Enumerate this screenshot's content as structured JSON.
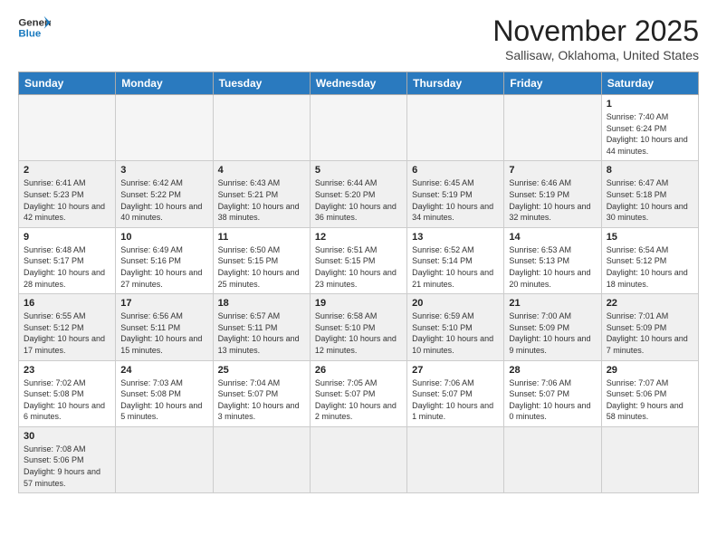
{
  "header": {
    "logo_general": "General",
    "logo_blue": "Blue",
    "month_title": "November 2025",
    "location": "Sallisaw, Oklahoma, United States"
  },
  "days_of_week": [
    "Sunday",
    "Monday",
    "Tuesday",
    "Wednesday",
    "Thursday",
    "Friday",
    "Saturday"
  ],
  "weeks": [
    [
      {
        "day": "",
        "info": ""
      },
      {
        "day": "",
        "info": ""
      },
      {
        "day": "",
        "info": ""
      },
      {
        "day": "",
        "info": ""
      },
      {
        "day": "",
        "info": ""
      },
      {
        "day": "",
        "info": ""
      },
      {
        "day": "1",
        "info": "Sunrise: 7:40 AM\nSunset: 6:24 PM\nDaylight: 10 hours and 44 minutes."
      }
    ],
    [
      {
        "day": "2",
        "info": "Sunrise: 6:41 AM\nSunset: 5:23 PM\nDaylight: 10 hours and 42 minutes."
      },
      {
        "day": "3",
        "info": "Sunrise: 6:42 AM\nSunset: 5:22 PM\nDaylight: 10 hours and 40 minutes."
      },
      {
        "day": "4",
        "info": "Sunrise: 6:43 AM\nSunset: 5:21 PM\nDaylight: 10 hours and 38 minutes."
      },
      {
        "day": "5",
        "info": "Sunrise: 6:44 AM\nSunset: 5:20 PM\nDaylight: 10 hours and 36 minutes."
      },
      {
        "day": "6",
        "info": "Sunrise: 6:45 AM\nSunset: 5:19 PM\nDaylight: 10 hours and 34 minutes."
      },
      {
        "day": "7",
        "info": "Sunrise: 6:46 AM\nSunset: 5:19 PM\nDaylight: 10 hours and 32 minutes."
      },
      {
        "day": "8",
        "info": "Sunrise: 6:47 AM\nSunset: 5:18 PM\nDaylight: 10 hours and 30 minutes."
      }
    ],
    [
      {
        "day": "9",
        "info": "Sunrise: 6:48 AM\nSunset: 5:17 PM\nDaylight: 10 hours and 28 minutes."
      },
      {
        "day": "10",
        "info": "Sunrise: 6:49 AM\nSunset: 5:16 PM\nDaylight: 10 hours and 27 minutes."
      },
      {
        "day": "11",
        "info": "Sunrise: 6:50 AM\nSunset: 5:15 PM\nDaylight: 10 hours and 25 minutes."
      },
      {
        "day": "12",
        "info": "Sunrise: 6:51 AM\nSunset: 5:15 PM\nDaylight: 10 hours and 23 minutes."
      },
      {
        "day": "13",
        "info": "Sunrise: 6:52 AM\nSunset: 5:14 PM\nDaylight: 10 hours and 21 minutes."
      },
      {
        "day": "14",
        "info": "Sunrise: 6:53 AM\nSunset: 5:13 PM\nDaylight: 10 hours and 20 minutes."
      },
      {
        "day": "15",
        "info": "Sunrise: 6:54 AM\nSunset: 5:12 PM\nDaylight: 10 hours and 18 minutes."
      }
    ],
    [
      {
        "day": "16",
        "info": "Sunrise: 6:55 AM\nSunset: 5:12 PM\nDaylight: 10 hours and 17 minutes."
      },
      {
        "day": "17",
        "info": "Sunrise: 6:56 AM\nSunset: 5:11 PM\nDaylight: 10 hours and 15 minutes."
      },
      {
        "day": "18",
        "info": "Sunrise: 6:57 AM\nSunset: 5:11 PM\nDaylight: 10 hours and 13 minutes."
      },
      {
        "day": "19",
        "info": "Sunrise: 6:58 AM\nSunset: 5:10 PM\nDaylight: 10 hours and 12 minutes."
      },
      {
        "day": "20",
        "info": "Sunrise: 6:59 AM\nSunset: 5:10 PM\nDaylight: 10 hours and 10 minutes."
      },
      {
        "day": "21",
        "info": "Sunrise: 7:00 AM\nSunset: 5:09 PM\nDaylight: 10 hours and 9 minutes."
      },
      {
        "day": "22",
        "info": "Sunrise: 7:01 AM\nSunset: 5:09 PM\nDaylight: 10 hours and 7 minutes."
      }
    ],
    [
      {
        "day": "23",
        "info": "Sunrise: 7:02 AM\nSunset: 5:08 PM\nDaylight: 10 hours and 6 minutes."
      },
      {
        "day": "24",
        "info": "Sunrise: 7:03 AM\nSunset: 5:08 PM\nDaylight: 10 hours and 5 minutes."
      },
      {
        "day": "25",
        "info": "Sunrise: 7:04 AM\nSunset: 5:07 PM\nDaylight: 10 hours and 3 minutes."
      },
      {
        "day": "26",
        "info": "Sunrise: 7:05 AM\nSunset: 5:07 PM\nDaylight: 10 hours and 2 minutes."
      },
      {
        "day": "27",
        "info": "Sunrise: 7:06 AM\nSunset: 5:07 PM\nDaylight: 10 hours and 1 minute."
      },
      {
        "day": "28",
        "info": "Sunrise: 7:06 AM\nSunset: 5:07 PM\nDaylight: 10 hours and 0 minutes."
      },
      {
        "day": "29",
        "info": "Sunrise: 7:07 AM\nSunset: 5:06 PM\nDaylight: 9 hours and 58 minutes."
      }
    ],
    [
      {
        "day": "30",
        "info": "Sunrise: 7:08 AM\nSunset: 5:06 PM\nDaylight: 9 hours and 57 minutes."
      },
      {
        "day": "",
        "info": ""
      },
      {
        "day": "",
        "info": ""
      },
      {
        "day": "",
        "info": ""
      },
      {
        "day": "",
        "info": ""
      },
      {
        "day": "",
        "info": ""
      },
      {
        "day": "",
        "info": ""
      }
    ]
  ]
}
